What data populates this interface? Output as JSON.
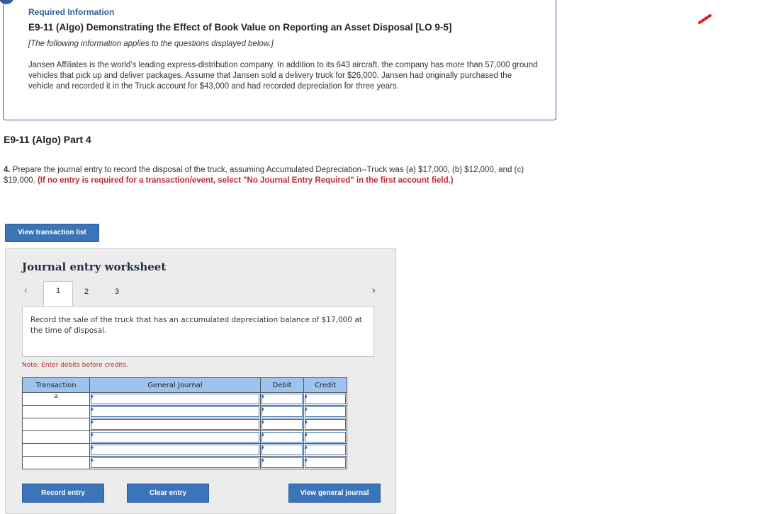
{
  "info": {
    "header": "Required Information",
    "title": "E9-11 (Algo) Demonstrating the Effect of Book Value on Reporting an Asset Disposal [LO 9-5]",
    "note": "[The following information applies to the questions displayed below.]",
    "paragraph": "Jansen Affiliates is the world’s leading express-distribution company. In addition to its 643 aircraft, the company has more than 57,000 ground vehicles that pick up and deliver packages. Assume that Jansen sold a delivery truck for $26,000. Jansen had originally purchased the vehicle and recorded it in the Truck account for $43,000 and had recorded depreciation for three years."
  },
  "part_title": "E9-11 (Algo) Part 4",
  "question": {
    "number": "4.",
    "text": " Prepare the journal entry to record the disposal of the truck, assuming Accumulated Depreciation--Truck was (a) $17,000, (b) $12,000, and (c) $19,000. ",
    "instruction": "(If no entry is required for a transaction/event, select \"No Journal Entry Required\" in the first account field.)"
  },
  "buttons": {
    "view_transaction_list": "View transaction list",
    "record_entry": "Record entry",
    "clear_entry": "Clear entry",
    "view_general_journal": "View general journal"
  },
  "worksheet": {
    "title": "Journal entry worksheet",
    "tabs": [
      "1",
      "2",
      "3"
    ],
    "active_tab": "1",
    "prompt": "Record the sale of the truck that has an accumulated depreciation balance of $17,000 at the time of disposal.",
    "note": "Note: Enter debits before credits.",
    "columns": [
      "Transaction",
      "General Journal",
      "Debit",
      "Credit"
    ],
    "rows": [
      {
        "transaction": "a",
        "account": "",
        "debit": "",
        "credit": ""
      },
      {
        "transaction": "",
        "account": "",
        "debit": "",
        "credit": ""
      },
      {
        "transaction": "",
        "account": "",
        "debit": "",
        "credit": ""
      },
      {
        "transaction": "",
        "account": "",
        "debit": "",
        "credit": ""
      },
      {
        "transaction": "",
        "account": "",
        "debit": "",
        "credit": ""
      },
      {
        "transaction": "",
        "account": "",
        "debit": "",
        "credit": ""
      }
    ]
  },
  "colors": {
    "accent_blue": "#3b74b8",
    "header_blue": "#9ec4ec",
    "instruction_red": "#c0282d"
  }
}
